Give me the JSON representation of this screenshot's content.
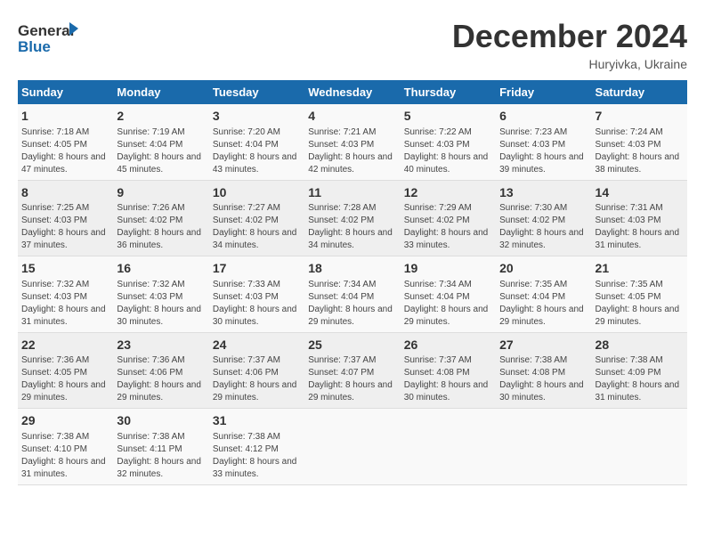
{
  "logo": {
    "line1": "General",
    "line2": "Blue"
  },
  "title": "December 2024",
  "location": "Huryivka, Ukraine",
  "days_of_week": [
    "Sunday",
    "Monday",
    "Tuesday",
    "Wednesday",
    "Thursday",
    "Friday",
    "Saturday"
  ],
  "weeks": [
    [
      {
        "day": "1",
        "info": "Sunrise: 7:18 AM\nSunset: 4:05 PM\nDaylight: 8 hours and 47 minutes."
      },
      {
        "day": "2",
        "info": "Sunrise: 7:19 AM\nSunset: 4:04 PM\nDaylight: 8 hours and 45 minutes."
      },
      {
        "day": "3",
        "info": "Sunrise: 7:20 AM\nSunset: 4:04 PM\nDaylight: 8 hours and 43 minutes."
      },
      {
        "day": "4",
        "info": "Sunrise: 7:21 AM\nSunset: 4:03 PM\nDaylight: 8 hours and 42 minutes."
      },
      {
        "day": "5",
        "info": "Sunrise: 7:22 AM\nSunset: 4:03 PM\nDaylight: 8 hours and 40 minutes."
      },
      {
        "day": "6",
        "info": "Sunrise: 7:23 AM\nSunset: 4:03 PM\nDaylight: 8 hours and 39 minutes."
      },
      {
        "day": "7",
        "info": "Sunrise: 7:24 AM\nSunset: 4:03 PM\nDaylight: 8 hours and 38 minutes."
      }
    ],
    [
      {
        "day": "8",
        "info": "Sunrise: 7:25 AM\nSunset: 4:03 PM\nDaylight: 8 hours and 37 minutes."
      },
      {
        "day": "9",
        "info": "Sunrise: 7:26 AM\nSunset: 4:02 PM\nDaylight: 8 hours and 36 minutes."
      },
      {
        "day": "10",
        "info": "Sunrise: 7:27 AM\nSunset: 4:02 PM\nDaylight: 8 hours and 34 minutes."
      },
      {
        "day": "11",
        "info": "Sunrise: 7:28 AM\nSunset: 4:02 PM\nDaylight: 8 hours and 34 minutes."
      },
      {
        "day": "12",
        "info": "Sunrise: 7:29 AM\nSunset: 4:02 PM\nDaylight: 8 hours and 33 minutes."
      },
      {
        "day": "13",
        "info": "Sunrise: 7:30 AM\nSunset: 4:02 PM\nDaylight: 8 hours and 32 minutes."
      },
      {
        "day": "14",
        "info": "Sunrise: 7:31 AM\nSunset: 4:03 PM\nDaylight: 8 hours and 31 minutes."
      }
    ],
    [
      {
        "day": "15",
        "info": "Sunrise: 7:32 AM\nSunset: 4:03 PM\nDaylight: 8 hours and 31 minutes."
      },
      {
        "day": "16",
        "info": "Sunrise: 7:32 AM\nSunset: 4:03 PM\nDaylight: 8 hours and 30 minutes."
      },
      {
        "day": "17",
        "info": "Sunrise: 7:33 AM\nSunset: 4:03 PM\nDaylight: 8 hours and 30 minutes."
      },
      {
        "day": "18",
        "info": "Sunrise: 7:34 AM\nSunset: 4:04 PM\nDaylight: 8 hours and 29 minutes."
      },
      {
        "day": "19",
        "info": "Sunrise: 7:34 AM\nSunset: 4:04 PM\nDaylight: 8 hours and 29 minutes."
      },
      {
        "day": "20",
        "info": "Sunrise: 7:35 AM\nSunset: 4:04 PM\nDaylight: 8 hours and 29 minutes."
      },
      {
        "day": "21",
        "info": "Sunrise: 7:35 AM\nSunset: 4:05 PM\nDaylight: 8 hours and 29 minutes."
      }
    ],
    [
      {
        "day": "22",
        "info": "Sunrise: 7:36 AM\nSunset: 4:05 PM\nDaylight: 8 hours and 29 minutes."
      },
      {
        "day": "23",
        "info": "Sunrise: 7:36 AM\nSunset: 4:06 PM\nDaylight: 8 hours and 29 minutes."
      },
      {
        "day": "24",
        "info": "Sunrise: 7:37 AM\nSunset: 4:06 PM\nDaylight: 8 hours and 29 minutes."
      },
      {
        "day": "25",
        "info": "Sunrise: 7:37 AM\nSunset: 4:07 PM\nDaylight: 8 hours and 29 minutes."
      },
      {
        "day": "26",
        "info": "Sunrise: 7:37 AM\nSunset: 4:08 PM\nDaylight: 8 hours and 30 minutes."
      },
      {
        "day": "27",
        "info": "Sunrise: 7:38 AM\nSunset: 4:08 PM\nDaylight: 8 hours and 30 minutes."
      },
      {
        "day": "28",
        "info": "Sunrise: 7:38 AM\nSunset: 4:09 PM\nDaylight: 8 hours and 31 minutes."
      }
    ],
    [
      {
        "day": "29",
        "info": "Sunrise: 7:38 AM\nSunset: 4:10 PM\nDaylight: 8 hours and 31 minutes."
      },
      {
        "day": "30",
        "info": "Sunrise: 7:38 AM\nSunset: 4:11 PM\nDaylight: 8 hours and 32 minutes."
      },
      {
        "day": "31",
        "info": "Sunrise: 7:38 AM\nSunset: 4:12 PM\nDaylight: 8 hours and 33 minutes."
      },
      {
        "day": "",
        "info": ""
      },
      {
        "day": "",
        "info": ""
      },
      {
        "day": "",
        "info": ""
      },
      {
        "day": "",
        "info": ""
      }
    ]
  ]
}
